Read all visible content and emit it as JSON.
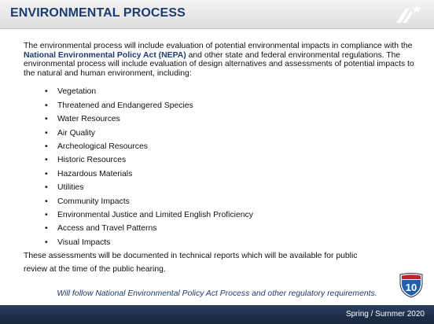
{
  "header": {
    "title": "ENVIRONMENTAL PROCESS"
  },
  "content": {
    "intro_before": "The environmental process will include evaluation of potential environmental impacts in compliance with the ",
    "intro_nepa": "National Environmental Policy Act (NEPA)",
    "intro_after": " and other state and federal environmental regulations. The environmental process will include evaluation of design alternatives and assessments of potential impacts to the natural and human environment, including:",
    "bullets": [
      "Vegetation",
      "Threatened and Endangered Species",
      "Water Resources",
      "Air Quality",
      "Archeological Resources",
      "Historic Resources",
      "Hazardous Materials",
      "Utilities",
      "Community Impacts",
      "Environmental Justice and Limited English Proficiency",
      "Access and Travel Patterns",
      "Visual Impacts"
    ],
    "closing_line1": "These assessments will be documented in technical reports which will be available for public",
    "closing_line2": "review at the time of the public hearing."
  },
  "note": "Will follow National Environmental Policy Act Process and other regulatory requirements.",
  "interstate_badge": "10",
  "footer": {
    "season": "Spring / Summer 2020"
  },
  "colors": {
    "title": "#1d3b70",
    "footer_bg": "#1f2d47",
    "shield_blue": "#1f5fae",
    "shield_red": "#c8202f"
  }
}
